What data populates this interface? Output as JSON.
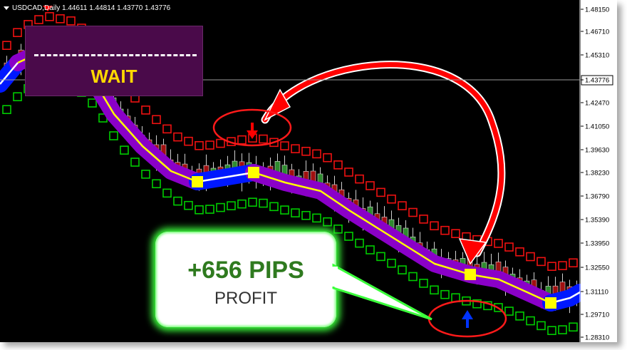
{
  "chart": {
    "symbol_title": "USDCAD,Daily  1.44611 1.44814 1.43770 1.43776",
    "current_price": "1.43776",
    "price_axis": [
      "1.48150",
      "1.46710",
      "1.45310",
      "1.43776",
      "1.42470",
      "1.41050",
      "1.39630",
      "1.38230",
      "1.36790",
      "1.35390",
      "1.33950",
      "1.32550",
      "1.31110",
      "1.29710",
      "1.28310"
    ]
  },
  "wait_panel": {
    "label": "WAIT"
  },
  "profit_callout": {
    "pips": "+656 PIPS",
    "word": "PROFIT"
  },
  "colors": {
    "background": "#000000",
    "up_band": "#00cc00",
    "down_band": "#ee1111",
    "trend_down": "#8a00c8",
    "trend_up": "#0018ff",
    "midline": "#ffff00",
    "arrow_red": "#ff0000",
    "arrow_blue": "#0033ff",
    "callout_glow": "#3cff3c"
  },
  "icons": {
    "sell_signal": "red-down-arrow-icon",
    "buy_signal": "blue-up-arrow-icon",
    "menu": "triangle-down-icon"
  }
}
